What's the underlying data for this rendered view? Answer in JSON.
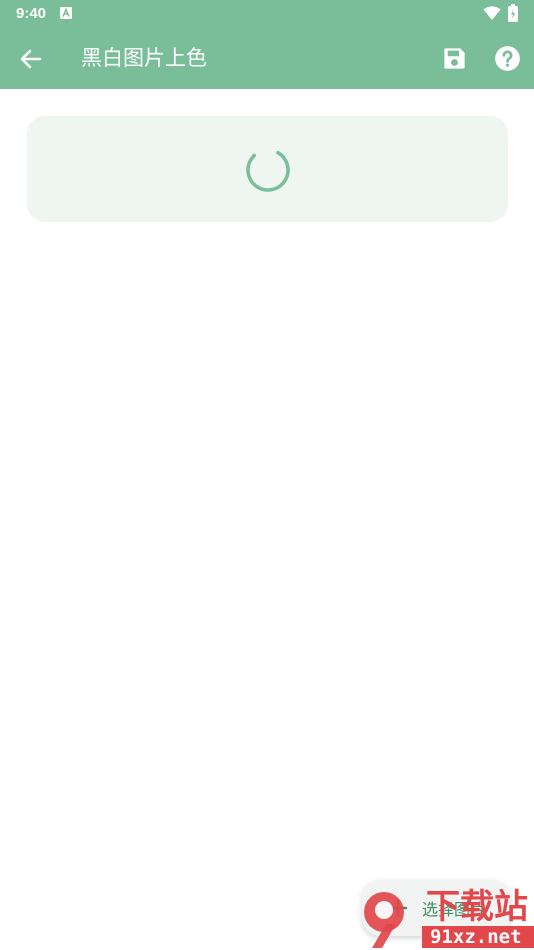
{
  "status_bar": {
    "time": "9:40",
    "icons": [
      "notification-a-icon",
      "wifi-icon",
      "battery-icon"
    ]
  },
  "toolbar": {
    "title": "黑白图片上色",
    "icons": {
      "back": "arrow-left-icon",
      "save": "save-icon",
      "help": "help-icon"
    }
  },
  "content": {
    "loading_state": "spinner"
  },
  "fab": {
    "label": "选择图片",
    "icon": "plus-icon"
  },
  "watermark": {
    "brand_text": "下载站",
    "domain_text": "91xz.net"
  },
  "colors": {
    "accent": "#79be98",
    "card_background": "#eff6f1",
    "watermark_red": "#e2474b"
  }
}
